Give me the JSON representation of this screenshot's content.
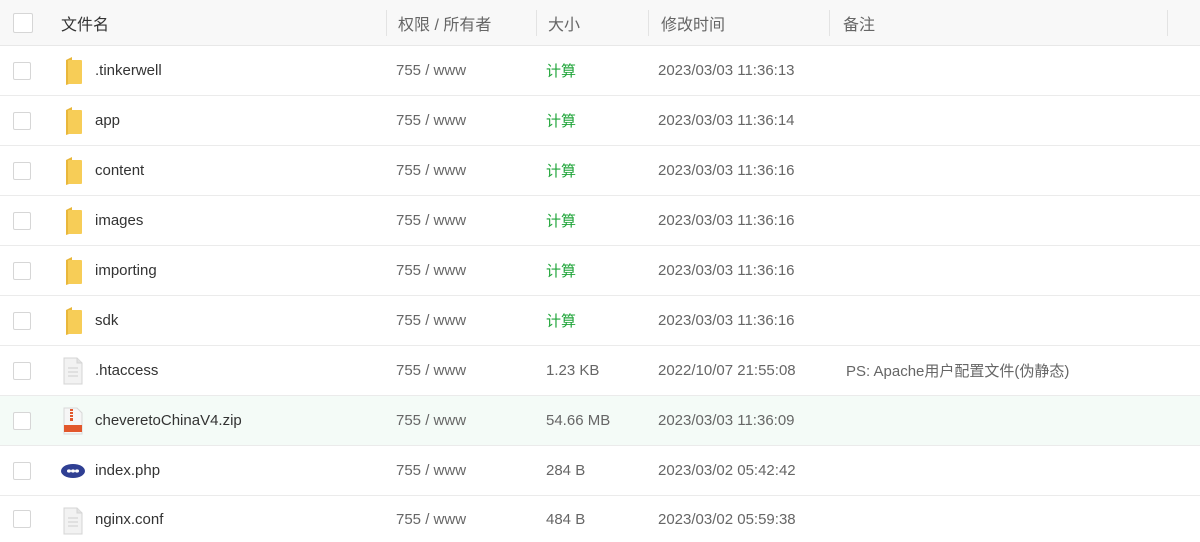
{
  "header": {
    "name": "文件名",
    "perm": "权限 / 所有者",
    "size": "大小",
    "time": "修改时间",
    "note": "备注"
  },
  "colors": {
    "calc": "#20a53a",
    "highlight": "#f4fbf7",
    "folder": "#f5c94a"
  },
  "files": [
    {
      "icon": "folder-icon",
      "name": ".tinkerwell",
      "perm": "755 / www",
      "size": "计算",
      "time": "2023/03/03 11:36:13",
      "note": ""
    },
    {
      "icon": "folder-icon",
      "name": "app",
      "perm": "755 / www",
      "size": "计算",
      "time": "2023/03/03 11:36:14",
      "note": ""
    },
    {
      "icon": "folder-icon",
      "name": "content",
      "perm": "755 / www",
      "size": "计算",
      "time": "2023/03/03 11:36:16",
      "note": ""
    },
    {
      "icon": "folder-icon",
      "name": "images",
      "perm": "755 / www",
      "size": "计算",
      "time": "2023/03/03 11:36:16",
      "note": ""
    },
    {
      "icon": "folder-icon",
      "name": "importing",
      "perm": "755 / www",
      "size": "计算",
      "time": "2023/03/03 11:36:16",
      "note": ""
    },
    {
      "icon": "folder-icon",
      "name": "sdk",
      "perm": "755 / www",
      "size": "计算",
      "time": "2023/03/03 11:36:16",
      "note": ""
    },
    {
      "icon": "text-file-icon",
      "name": ".htaccess",
      "perm": "755 / www",
      "size": "1.23 KB",
      "time": "2022/10/07 21:55:08",
      "note": "PS: Apache用户配置文件(伪静态)"
    },
    {
      "icon": "zip-file-icon",
      "name": "cheveretoChinaV4.zip",
      "perm": "755 / www",
      "size": "54.66 MB",
      "time": "2023/03/03 11:36:09",
      "note": ""
    },
    {
      "icon": "php-file-icon",
      "name": "index.php",
      "perm": "755 / www",
      "size": "284 B",
      "time": "2023/03/02 05:42:42",
      "note": ""
    },
    {
      "icon": "text-file-icon",
      "name": "nginx.conf",
      "perm": "755 / www",
      "size": "484 B",
      "time": "2023/03/02 05:59:38",
      "note": ""
    }
  ]
}
